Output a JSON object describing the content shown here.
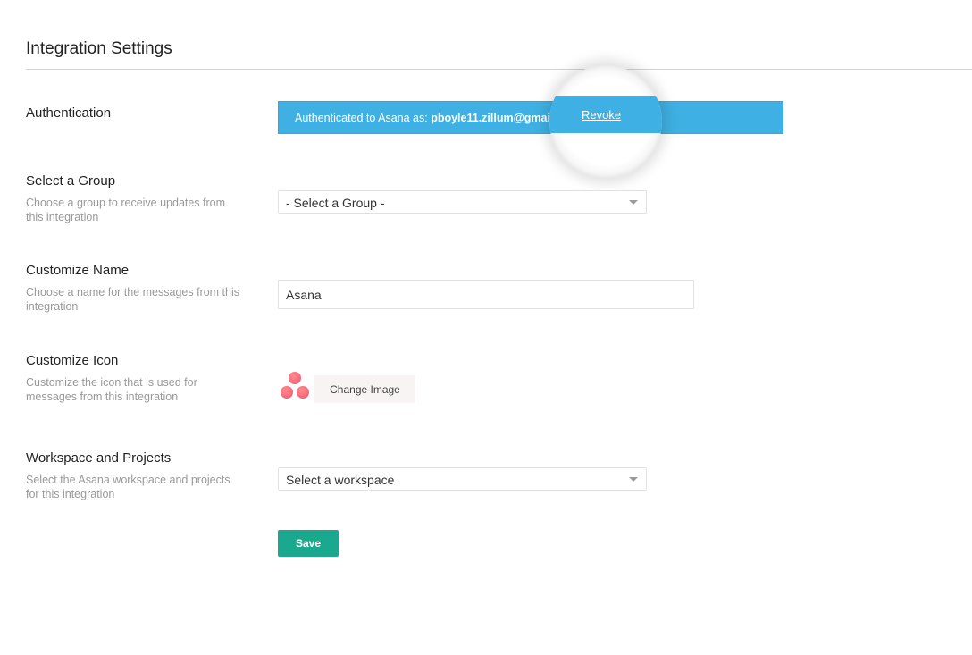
{
  "page": {
    "title": "Integration Settings"
  },
  "authentication": {
    "label": "Authentication",
    "status_prefix": "Authenticated to Asana as:",
    "email": "pboyle11.zillum@gmail.co",
    "revoke_label": "Revoke",
    "bar_color": "#3fb0e3"
  },
  "group": {
    "label": "Select a Group",
    "description": "Choose a group to receive updates from this integration",
    "selected": "- Select a Group -"
  },
  "name": {
    "label": "Customize Name",
    "description": "Choose a name for the messages from this integration",
    "value": "Asana"
  },
  "icon": {
    "label": "Customize Icon",
    "description": "Customize the icon that is used for messages from this integration",
    "logo": "asana-logo-icon",
    "change_label": "Change Image"
  },
  "workspace": {
    "label": "Workspace and Projects",
    "description": "Select the Asana workspace and projects for this integration",
    "selected": "Select a workspace"
  },
  "actions": {
    "save_label": "Save",
    "save_color": "#1aa98e"
  }
}
